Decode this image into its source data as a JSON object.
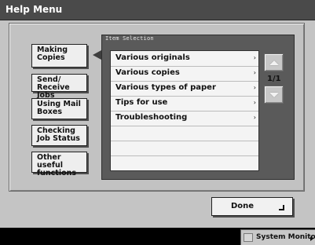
{
  "window": {
    "title": "Help Menu"
  },
  "nav": {
    "items": [
      {
        "label": "Making\nCopies",
        "selected": true
      },
      {
        "label": "Send/\nReceive Jobs"
      },
      {
        "label": "Using Mail\nBoxes"
      },
      {
        "label": "Checking\nJob Status"
      },
      {
        "label": "Other useful\nfunctions"
      }
    ]
  },
  "item_selection": {
    "header": "Item Selection",
    "items": [
      {
        "label": "Various originals"
      },
      {
        "label": "Various copies"
      },
      {
        "label": "Various types of paper"
      },
      {
        "label": "Tips for use"
      },
      {
        "label": "Troubleshooting"
      },
      {
        "label": ""
      },
      {
        "label": ""
      },
      {
        "label": ""
      }
    ],
    "row_arrow": "›",
    "page": "1/1"
  },
  "footer": {
    "done_label": "Done"
  },
  "system_monitor": {
    "label": "System Monitor"
  },
  "icons": {
    "scroll_up": "triangle-up-icon",
    "scroll_down": "triangle-down-icon",
    "done": "enter-return-icon",
    "monitor": "monitor-icon"
  }
}
